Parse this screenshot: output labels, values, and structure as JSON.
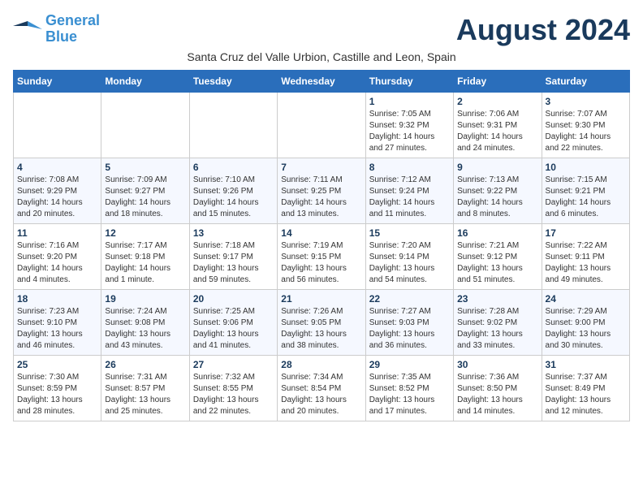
{
  "header": {
    "logo_line1": "General",
    "logo_line2": "Blue",
    "month_title": "August 2024",
    "subtitle": "Santa Cruz del Valle Urbion, Castille and Leon, Spain"
  },
  "weekdays": [
    "Sunday",
    "Monday",
    "Tuesday",
    "Wednesday",
    "Thursday",
    "Friday",
    "Saturday"
  ],
  "weeks": [
    [
      {
        "day": "",
        "info": ""
      },
      {
        "day": "",
        "info": ""
      },
      {
        "day": "",
        "info": ""
      },
      {
        "day": "",
        "info": ""
      },
      {
        "day": "1",
        "info": "Sunrise: 7:05 AM\nSunset: 9:32 PM\nDaylight: 14 hours\nand 27 minutes."
      },
      {
        "day": "2",
        "info": "Sunrise: 7:06 AM\nSunset: 9:31 PM\nDaylight: 14 hours\nand 24 minutes."
      },
      {
        "day": "3",
        "info": "Sunrise: 7:07 AM\nSunset: 9:30 PM\nDaylight: 14 hours\nand 22 minutes."
      }
    ],
    [
      {
        "day": "4",
        "info": "Sunrise: 7:08 AM\nSunset: 9:29 PM\nDaylight: 14 hours\nand 20 minutes."
      },
      {
        "day": "5",
        "info": "Sunrise: 7:09 AM\nSunset: 9:27 PM\nDaylight: 14 hours\nand 18 minutes."
      },
      {
        "day": "6",
        "info": "Sunrise: 7:10 AM\nSunset: 9:26 PM\nDaylight: 14 hours\nand 15 minutes."
      },
      {
        "day": "7",
        "info": "Sunrise: 7:11 AM\nSunset: 9:25 PM\nDaylight: 14 hours\nand 13 minutes."
      },
      {
        "day": "8",
        "info": "Sunrise: 7:12 AM\nSunset: 9:24 PM\nDaylight: 14 hours\nand 11 minutes."
      },
      {
        "day": "9",
        "info": "Sunrise: 7:13 AM\nSunset: 9:22 PM\nDaylight: 14 hours\nand 8 minutes."
      },
      {
        "day": "10",
        "info": "Sunrise: 7:15 AM\nSunset: 9:21 PM\nDaylight: 14 hours\nand 6 minutes."
      }
    ],
    [
      {
        "day": "11",
        "info": "Sunrise: 7:16 AM\nSunset: 9:20 PM\nDaylight: 14 hours\nand 4 minutes."
      },
      {
        "day": "12",
        "info": "Sunrise: 7:17 AM\nSunset: 9:18 PM\nDaylight: 14 hours\nand 1 minute."
      },
      {
        "day": "13",
        "info": "Sunrise: 7:18 AM\nSunset: 9:17 PM\nDaylight: 13 hours\nand 59 minutes."
      },
      {
        "day": "14",
        "info": "Sunrise: 7:19 AM\nSunset: 9:15 PM\nDaylight: 13 hours\nand 56 minutes."
      },
      {
        "day": "15",
        "info": "Sunrise: 7:20 AM\nSunset: 9:14 PM\nDaylight: 13 hours\nand 54 minutes."
      },
      {
        "day": "16",
        "info": "Sunrise: 7:21 AM\nSunset: 9:12 PM\nDaylight: 13 hours\nand 51 minutes."
      },
      {
        "day": "17",
        "info": "Sunrise: 7:22 AM\nSunset: 9:11 PM\nDaylight: 13 hours\nand 49 minutes."
      }
    ],
    [
      {
        "day": "18",
        "info": "Sunrise: 7:23 AM\nSunset: 9:10 PM\nDaylight: 13 hours\nand 46 minutes."
      },
      {
        "day": "19",
        "info": "Sunrise: 7:24 AM\nSunset: 9:08 PM\nDaylight: 13 hours\nand 43 minutes."
      },
      {
        "day": "20",
        "info": "Sunrise: 7:25 AM\nSunset: 9:06 PM\nDaylight: 13 hours\nand 41 minutes."
      },
      {
        "day": "21",
        "info": "Sunrise: 7:26 AM\nSunset: 9:05 PM\nDaylight: 13 hours\nand 38 minutes."
      },
      {
        "day": "22",
        "info": "Sunrise: 7:27 AM\nSunset: 9:03 PM\nDaylight: 13 hours\nand 36 minutes."
      },
      {
        "day": "23",
        "info": "Sunrise: 7:28 AM\nSunset: 9:02 PM\nDaylight: 13 hours\nand 33 minutes."
      },
      {
        "day": "24",
        "info": "Sunrise: 7:29 AM\nSunset: 9:00 PM\nDaylight: 13 hours\nand 30 minutes."
      }
    ],
    [
      {
        "day": "25",
        "info": "Sunrise: 7:30 AM\nSunset: 8:59 PM\nDaylight: 13 hours\nand 28 minutes."
      },
      {
        "day": "26",
        "info": "Sunrise: 7:31 AM\nSunset: 8:57 PM\nDaylight: 13 hours\nand 25 minutes."
      },
      {
        "day": "27",
        "info": "Sunrise: 7:32 AM\nSunset: 8:55 PM\nDaylight: 13 hours\nand 22 minutes."
      },
      {
        "day": "28",
        "info": "Sunrise: 7:34 AM\nSunset: 8:54 PM\nDaylight: 13 hours\nand 20 minutes."
      },
      {
        "day": "29",
        "info": "Sunrise: 7:35 AM\nSunset: 8:52 PM\nDaylight: 13 hours\nand 17 minutes."
      },
      {
        "day": "30",
        "info": "Sunrise: 7:36 AM\nSunset: 8:50 PM\nDaylight: 13 hours\nand 14 minutes."
      },
      {
        "day": "31",
        "info": "Sunrise: 7:37 AM\nSunset: 8:49 PM\nDaylight: 13 hours\nand 12 minutes."
      }
    ]
  ]
}
